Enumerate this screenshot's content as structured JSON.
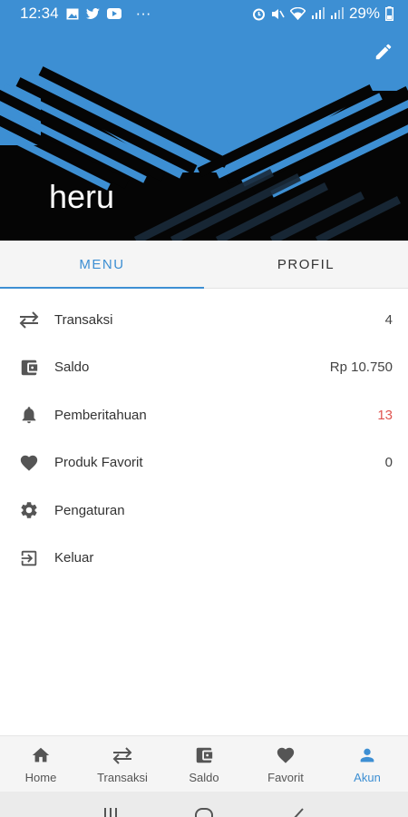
{
  "status_bar": {
    "time": "12:34",
    "more": "···",
    "battery": "29%"
  },
  "header": {
    "username": "heru",
    "colors": {
      "background": "#3d8fd3",
      "stripe": "#000000"
    }
  },
  "tabs": [
    {
      "label": "MENU",
      "active": true
    },
    {
      "label": "PROFIL",
      "active": false
    }
  ],
  "menu": [
    {
      "label": "Transaksi",
      "value": "4",
      "icon": "swap-arrows-icon"
    },
    {
      "label": "Saldo",
      "value": "Rp 10.750",
      "icon": "wallet-icon"
    },
    {
      "label": "Pemberitahuan",
      "value": "13",
      "icon": "bell-icon"
    },
    {
      "label": "Produk Favorit",
      "value": "0",
      "icon": "heart-icon"
    },
    {
      "label": "Pengaturan",
      "value": "",
      "icon": "gear-icon"
    },
    {
      "label": "Keluar",
      "value": "",
      "icon": "logout-icon"
    }
  ],
  "bottom_nav": [
    {
      "label": "Home",
      "icon": "home-icon",
      "active": false
    },
    {
      "label": "Transaksi",
      "icon": "swap-arrows-icon",
      "active": false
    },
    {
      "label": "Saldo",
      "icon": "wallet-icon",
      "active": false
    },
    {
      "label": "Favorit",
      "icon": "heart-icon",
      "active": false
    },
    {
      "label": "Akun",
      "icon": "person-icon",
      "active": true
    }
  ],
  "accent_color": "#3d8fd3",
  "alert_color": "#e0544f"
}
